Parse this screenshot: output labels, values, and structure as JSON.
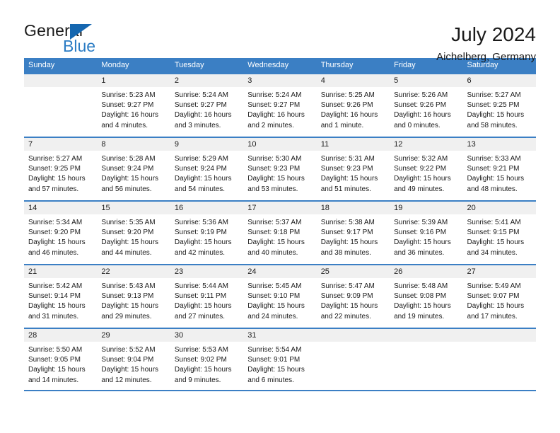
{
  "brand": {
    "name_part1": "General",
    "name_part2": "Blue",
    "accent_color": "#1567b0"
  },
  "header": {
    "title": "July 2024",
    "subtitle": "Aichelberg, Germany"
  },
  "theme": {
    "header_row_color": "#3b7fc4",
    "day_number_band_color": "#f0f0f0"
  },
  "calendar": {
    "weekdays": [
      "Sunday",
      "Monday",
      "Tuesday",
      "Wednesday",
      "Thursday",
      "Friday",
      "Saturday"
    ],
    "weeks": [
      [
        {
          "day": "",
          "empty": true
        },
        {
          "day": "1",
          "sunrise": "Sunrise: 5:23 AM",
          "sunset": "Sunset: 9:27 PM",
          "daylight": "Daylight: 16 hours and 4 minutes."
        },
        {
          "day": "2",
          "sunrise": "Sunrise: 5:24 AM",
          "sunset": "Sunset: 9:27 PM",
          "daylight": "Daylight: 16 hours and 3 minutes."
        },
        {
          "day": "3",
          "sunrise": "Sunrise: 5:24 AM",
          "sunset": "Sunset: 9:27 PM",
          "daylight": "Daylight: 16 hours and 2 minutes."
        },
        {
          "day": "4",
          "sunrise": "Sunrise: 5:25 AM",
          "sunset": "Sunset: 9:26 PM",
          "daylight": "Daylight: 16 hours and 1 minute."
        },
        {
          "day": "5",
          "sunrise": "Sunrise: 5:26 AM",
          "sunset": "Sunset: 9:26 PM",
          "daylight": "Daylight: 16 hours and 0 minutes."
        },
        {
          "day": "6",
          "sunrise": "Sunrise: 5:27 AM",
          "sunset": "Sunset: 9:25 PM",
          "daylight": "Daylight: 15 hours and 58 minutes."
        }
      ],
      [
        {
          "day": "7",
          "sunrise": "Sunrise: 5:27 AM",
          "sunset": "Sunset: 9:25 PM",
          "daylight": "Daylight: 15 hours and 57 minutes."
        },
        {
          "day": "8",
          "sunrise": "Sunrise: 5:28 AM",
          "sunset": "Sunset: 9:24 PM",
          "daylight": "Daylight: 15 hours and 56 minutes."
        },
        {
          "day": "9",
          "sunrise": "Sunrise: 5:29 AM",
          "sunset": "Sunset: 9:24 PM",
          "daylight": "Daylight: 15 hours and 54 minutes."
        },
        {
          "day": "10",
          "sunrise": "Sunrise: 5:30 AM",
          "sunset": "Sunset: 9:23 PM",
          "daylight": "Daylight: 15 hours and 53 minutes."
        },
        {
          "day": "11",
          "sunrise": "Sunrise: 5:31 AM",
          "sunset": "Sunset: 9:23 PM",
          "daylight": "Daylight: 15 hours and 51 minutes."
        },
        {
          "day": "12",
          "sunrise": "Sunrise: 5:32 AM",
          "sunset": "Sunset: 9:22 PM",
          "daylight": "Daylight: 15 hours and 49 minutes."
        },
        {
          "day": "13",
          "sunrise": "Sunrise: 5:33 AM",
          "sunset": "Sunset: 9:21 PM",
          "daylight": "Daylight: 15 hours and 48 minutes."
        }
      ],
      [
        {
          "day": "14",
          "sunrise": "Sunrise: 5:34 AM",
          "sunset": "Sunset: 9:20 PM",
          "daylight": "Daylight: 15 hours and 46 minutes."
        },
        {
          "day": "15",
          "sunrise": "Sunrise: 5:35 AM",
          "sunset": "Sunset: 9:20 PM",
          "daylight": "Daylight: 15 hours and 44 minutes."
        },
        {
          "day": "16",
          "sunrise": "Sunrise: 5:36 AM",
          "sunset": "Sunset: 9:19 PM",
          "daylight": "Daylight: 15 hours and 42 minutes."
        },
        {
          "day": "17",
          "sunrise": "Sunrise: 5:37 AM",
          "sunset": "Sunset: 9:18 PM",
          "daylight": "Daylight: 15 hours and 40 minutes."
        },
        {
          "day": "18",
          "sunrise": "Sunrise: 5:38 AM",
          "sunset": "Sunset: 9:17 PM",
          "daylight": "Daylight: 15 hours and 38 minutes."
        },
        {
          "day": "19",
          "sunrise": "Sunrise: 5:39 AM",
          "sunset": "Sunset: 9:16 PM",
          "daylight": "Daylight: 15 hours and 36 minutes."
        },
        {
          "day": "20",
          "sunrise": "Sunrise: 5:41 AM",
          "sunset": "Sunset: 9:15 PM",
          "daylight": "Daylight: 15 hours and 34 minutes."
        }
      ],
      [
        {
          "day": "21",
          "sunrise": "Sunrise: 5:42 AM",
          "sunset": "Sunset: 9:14 PM",
          "daylight": "Daylight: 15 hours and 31 minutes."
        },
        {
          "day": "22",
          "sunrise": "Sunrise: 5:43 AM",
          "sunset": "Sunset: 9:13 PM",
          "daylight": "Daylight: 15 hours and 29 minutes."
        },
        {
          "day": "23",
          "sunrise": "Sunrise: 5:44 AM",
          "sunset": "Sunset: 9:11 PM",
          "daylight": "Daylight: 15 hours and 27 minutes."
        },
        {
          "day": "24",
          "sunrise": "Sunrise: 5:45 AM",
          "sunset": "Sunset: 9:10 PM",
          "daylight": "Daylight: 15 hours and 24 minutes."
        },
        {
          "day": "25",
          "sunrise": "Sunrise: 5:47 AM",
          "sunset": "Sunset: 9:09 PM",
          "daylight": "Daylight: 15 hours and 22 minutes."
        },
        {
          "day": "26",
          "sunrise": "Sunrise: 5:48 AM",
          "sunset": "Sunset: 9:08 PM",
          "daylight": "Daylight: 15 hours and 19 minutes."
        },
        {
          "day": "27",
          "sunrise": "Sunrise: 5:49 AM",
          "sunset": "Sunset: 9:07 PM",
          "daylight": "Daylight: 15 hours and 17 minutes."
        }
      ],
      [
        {
          "day": "28",
          "sunrise": "Sunrise: 5:50 AM",
          "sunset": "Sunset: 9:05 PM",
          "daylight": "Daylight: 15 hours and 14 minutes."
        },
        {
          "day": "29",
          "sunrise": "Sunrise: 5:52 AM",
          "sunset": "Sunset: 9:04 PM",
          "daylight": "Daylight: 15 hours and 12 minutes."
        },
        {
          "day": "30",
          "sunrise": "Sunrise: 5:53 AM",
          "sunset": "Sunset: 9:02 PM",
          "daylight": "Daylight: 15 hours and 9 minutes."
        },
        {
          "day": "31",
          "sunrise": "Sunrise: 5:54 AM",
          "sunset": "Sunset: 9:01 PM",
          "daylight": "Daylight: 15 hours and 6 minutes."
        },
        {
          "day": "",
          "empty": true
        },
        {
          "day": "",
          "empty": true
        },
        {
          "day": "",
          "empty": true
        }
      ]
    ]
  }
}
